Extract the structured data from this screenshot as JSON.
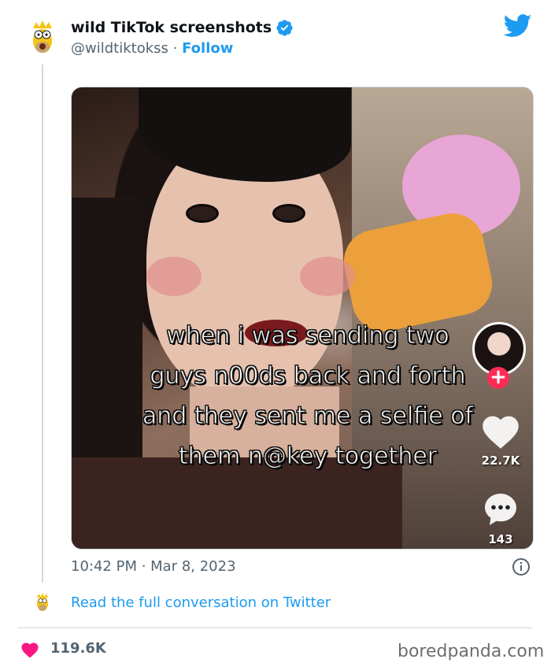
{
  "tweet": {
    "author_name": "wild TikTok screenshots",
    "handle": "@wildtiktokss",
    "separator": "·",
    "follow_label": "Follow",
    "timestamp": "10:42 PM · Mar 8, 2023",
    "read_link": "Read the full conversation on Twitter",
    "like_count": "119.6K"
  },
  "media": {
    "caption_lines": [
      "when i was sending two",
      "guys n00ds back and forth",
      "and they sent me a selfie of",
      "them n@key together"
    ],
    "tiktok": {
      "likes": "22.7K",
      "comments": "143",
      "plus": "+"
    }
  },
  "watermark": "boredpanda.com",
  "colors": {
    "twitter_blue": "#1d9bf0",
    "like_red": "#f91880",
    "tiktok_red": "#fe2c55",
    "text_gray": "#536471"
  },
  "icons": [
    "avatar-icon",
    "verified-badge-icon",
    "twitter-bird-icon",
    "info-icon",
    "heart-icon",
    "tiktok-heart-icon",
    "tiktok-comment-icon"
  ]
}
